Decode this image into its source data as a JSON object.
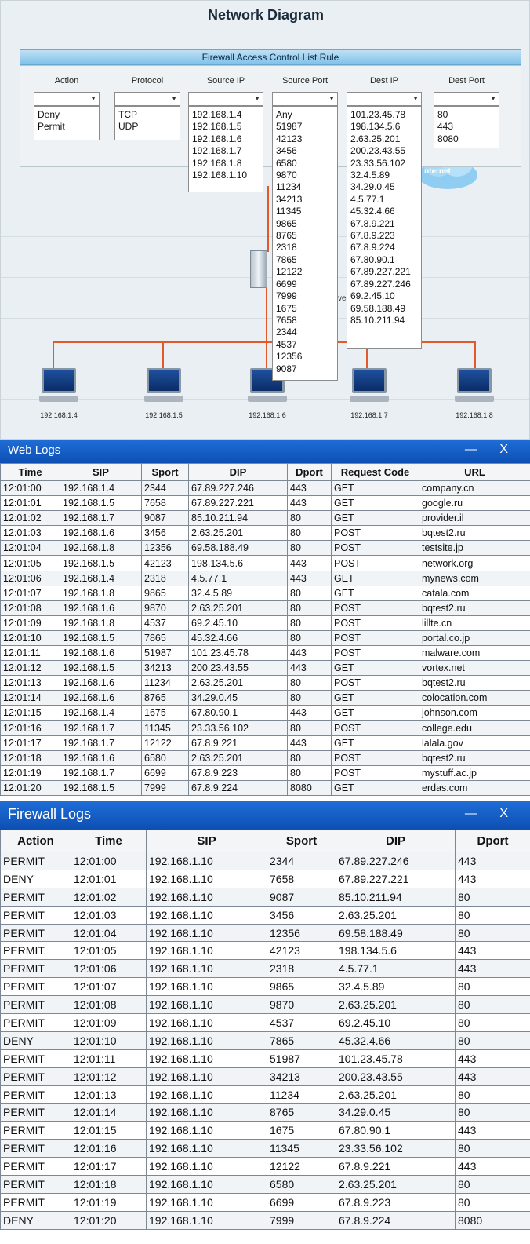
{
  "diagram": {
    "title": "Network Diagram",
    "acl_title": "Firewall Access Control List Rule",
    "columns": [
      "Action",
      "Protocol",
      "Source IP",
      "Source Port",
      "Dest IP",
      "Dest Port"
    ],
    "lists": {
      "action": [
        "Deny",
        "Permit"
      ],
      "protocol": [
        "TCP",
        "UDP"
      ],
      "source_ip": [
        "192.168.1.4",
        "192.168.1.5",
        "192.168.1.6",
        "192.168.1.7",
        "192.168.1.8",
        "192.168.1.10"
      ],
      "source_port": [
        "Any",
        "51987",
        "42123",
        "3456",
        "6580",
        "9870",
        "11234",
        "34213",
        "11345",
        "9865",
        "8765",
        "2318",
        "7865",
        "12122",
        "6699",
        "7999",
        "1675",
        "7658",
        "2344",
        "4537",
        "12356",
        "9087"
      ],
      "dest_ip": [
        "101.23.45.78",
        "198.134.5.6",
        "2.63.25.201",
        "200.23.43.55",
        "23.33.56.102",
        "32.4.5.89",
        "34.29.0.45",
        "4.5.77.1",
        "45.32.4.66",
        "67.8.9.221",
        "67.8.9.223",
        "67.8.9.224",
        "67.80.90.1",
        "67.89.227.221",
        "67.89.227.246",
        "69.2.45.10",
        "69.58.188.49",
        "85.10.211.94"
      ],
      "dest_port": [
        "80",
        "443",
        "8080"
      ]
    },
    "cloud_label": "nternet",
    "partial_label": "ve",
    "hosts": [
      "192.168.1.4",
      "192.168.1.5",
      "192.168.1.6",
      "192.168.1.7",
      "192.168.1.8"
    ]
  },
  "web_logs": {
    "title": "Web Logs",
    "controls": "— X",
    "headers": [
      "Time",
      "SIP",
      "Sport",
      "DIP",
      "Dport",
      "Request Code",
      "URL"
    ],
    "rows": [
      [
        "12:01:00",
        "192.168.1.4",
        "2344",
        "67.89.227.246",
        "443",
        "GET",
        "company.cn"
      ],
      [
        "12:01:01",
        "192.168.1.5",
        "7658",
        "67.89.227.221",
        "443",
        "GET",
        "google.ru"
      ],
      [
        "12:01:02",
        "192.168.1.7",
        "9087",
        "85.10.211.94",
        "80",
        "GET",
        "provider.il"
      ],
      [
        "12:01:03",
        "192.168.1.6",
        "3456",
        "2.63.25.201",
        "80",
        "POST",
        "bqtest2.ru"
      ],
      [
        "12:01:04",
        "192.168.1.8",
        "12356",
        "69.58.188.49",
        "80",
        "POST",
        "testsite.jp"
      ],
      [
        "12:01:05",
        "192.168.1.5",
        "42123",
        "198.134.5.6",
        "443",
        "POST",
        "network.org"
      ],
      [
        "12:01:06",
        "192.168.1.4",
        "2318",
        "4.5.77.1",
        "443",
        "GET",
        "mynews.com"
      ],
      [
        "12:01:07",
        "192.168.1.8",
        "9865",
        "32.4.5.89",
        "80",
        "GET",
        "catala.com"
      ],
      [
        "12:01:08",
        "192.168.1.6",
        "9870",
        "2.63.25.201",
        "80",
        "POST",
        "bqtest2.ru"
      ],
      [
        "12:01:09",
        "192.168.1.8",
        "4537",
        "69.2.45.10",
        "80",
        "POST",
        "lillte.cn"
      ],
      [
        "12:01:10",
        "192.168.1.5",
        "7865",
        "45.32.4.66",
        "80",
        "POST",
        "portal.co.jp"
      ],
      [
        "12:01:11",
        "192.168.1.6",
        "51987",
        "101.23.45.78",
        "443",
        "POST",
        "malware.com"
      ],
      [
        "12:01:12",
        "192.168.1.5",
        "34213",
        "200.23.43.55",
        "443",
        "GET",
        "vortex.net"
      ],
      [
        "12:01:13",
        "192.168.1.6",
        "11234",
        "2.63.25.201",
        "80",
        "POST",
        "bqtest2.ru"
      ],
      [
        "12:01:14",
        "192.168.1.6",
        "8765",
        "34.29.0.45",
        "80",
        "GET",
        "colocation.com"
      ],
      [
        "12:01:15",
        "192.168.1.4",
        "1675",
        "67.80.90.1",
        "443",
        "GET",
        "johnson.com"
      ],
      [
        "12:01:16",
        "192.168.1.7",
        "11345",
        "23.33.56.102",
        "80",
        "POST",
        "college.edu"
      ],
      [
        "12:01:17",
        "192.168.1.7",
        "12122",
        "67.8.9.221",
        "443",
        "GET",
        "lalala.gov"
      ],
      [
        "12:01:18",
        "192.168.1.6",
        "6580",
        "2.63.25.201",
        "80",
        "POST",
        "bqtest2.ru"
      ],
      [
        "12:01:19",
        "192.168.1.7",
        "6699",
        "67.8.9.223",
        "80",
        "POST",
        "mystuff.ac.jp"
      ],
      [
        "12:01:20",
        "192.168.1.5",
        "7999",
        "67.8.9.224",
        "8080",
        "GET",
        "erdas.com"
      ]
    ]
  },
  "firewall_logs": {
    "title": "Firewall Logs",
    "controls": "— X",
    "headers": [
      "Action",
      "Time",
      "SIP",
      "Sport",
      "DIP",
      "Dport"
    ],
    "rows": [
      [
        "PERMIT",
        "12:01:00",
        "192.168.1.10",
        "2344",
        "67.89.227.246",
        "443"
      ],
      [
        "DENY",
        "12:01:01",
        "192.168.1.10",
        "7658",
        "67.89.227.221",
        "443"
      ],
      [
        "PERMIT",
        "12:01:02",
        "192.168.1.10",
        "9087",
        "85.10.211.94",
        "80"
      ],
      [
        "PERMIT",
        "12:01:03",
        "192.168.1.10",
        "3456",
        "2.63.25.201",
        "80"
      ],
      [
        "PERMIT",
        "12:01:04",
        "192.168.1.10",
        "12356",
        "69.58.188.49",
        "80"
      ],
      [
        "PERMIT",
        "12:01:05",
        "192.168.1.10",
        "42123",
        "198.134.5.6",
        "443"
      ],
      [
        "PERMIT",
        "12:01:06",
        "192.168.1.10",
        "2318",
        "4.5.77.1",
        "443"
      ],
      [
        "PERMIT",
        "12:01:07",
        "192.168.1.10",
        "9865",
        "32.4.5.89",
        "80"
      ],
      [
        "PERMIT",
        "12:01:08",
        "192.168.1.10",
        "9870",
        "2.63.25.201",
        "80"
      ],
      [
        "PERMIT",
        "12:01:09",
        "192.168.1.10",
        "4537",
        "69.2.45.10",
        "80"
      ],
      [
        "DENY",
        "12:01:10",
        "192.168.1.10",
        "7865",
        "45.32.4.66",
        "80"
      ],
      [
        "PERMIT",
        "12:01:11",
        "192.168.1.10",
        "51987",
        "101.23.45.78",
        "443"
      ],
      [
        "PERMIT",
        "12:01:12",
        "192.168.1.10",
        "34213",
        "200.23.43.55",
        "443"
      ],
      [
        "PERMIT",
        "12:01:13",
        "192.168.1.10",
        "11234",
        "2.63.25.201",
        "80"
      ],
      [
        "PERMIT",
        "12:01:14",
        "192.168.1.10",
        "8765",
        "34.29.0.45",
        "80"
      ],
      [
        "PERMIT",
        "12:01:15",
        "192.168.1.10",
        "1675",
        "67.80.90.1",
        "443"
      ],
      [
        "PERMIT",
        "12:01:16",
        "192.168.1.10",
        "11345",
        "23.33.56.102",
        "80"
      ],
      [
        "PERMIT",
        "12:01:17",
        "192.168.1.10",
        "12122",
        "67.8.9.221",
        "443"
      ],
      [
        "PERMIT",
        "12:01:18",
        "192.168.1.10",
        "6580",
        "2.63.25.201",
        "80"
      ],
      [
        "PERMIT",
        "12:01:19",
        "192.168.1.10",
        "6699",
        "67.8.9.223",
        "80"
      ],
      [
        "DENY",
        "12:01:20",
        "192.168.1.10",
        "7999",
        "67.8.9.224",
        "8080"
      ]
    ]
  }
}
